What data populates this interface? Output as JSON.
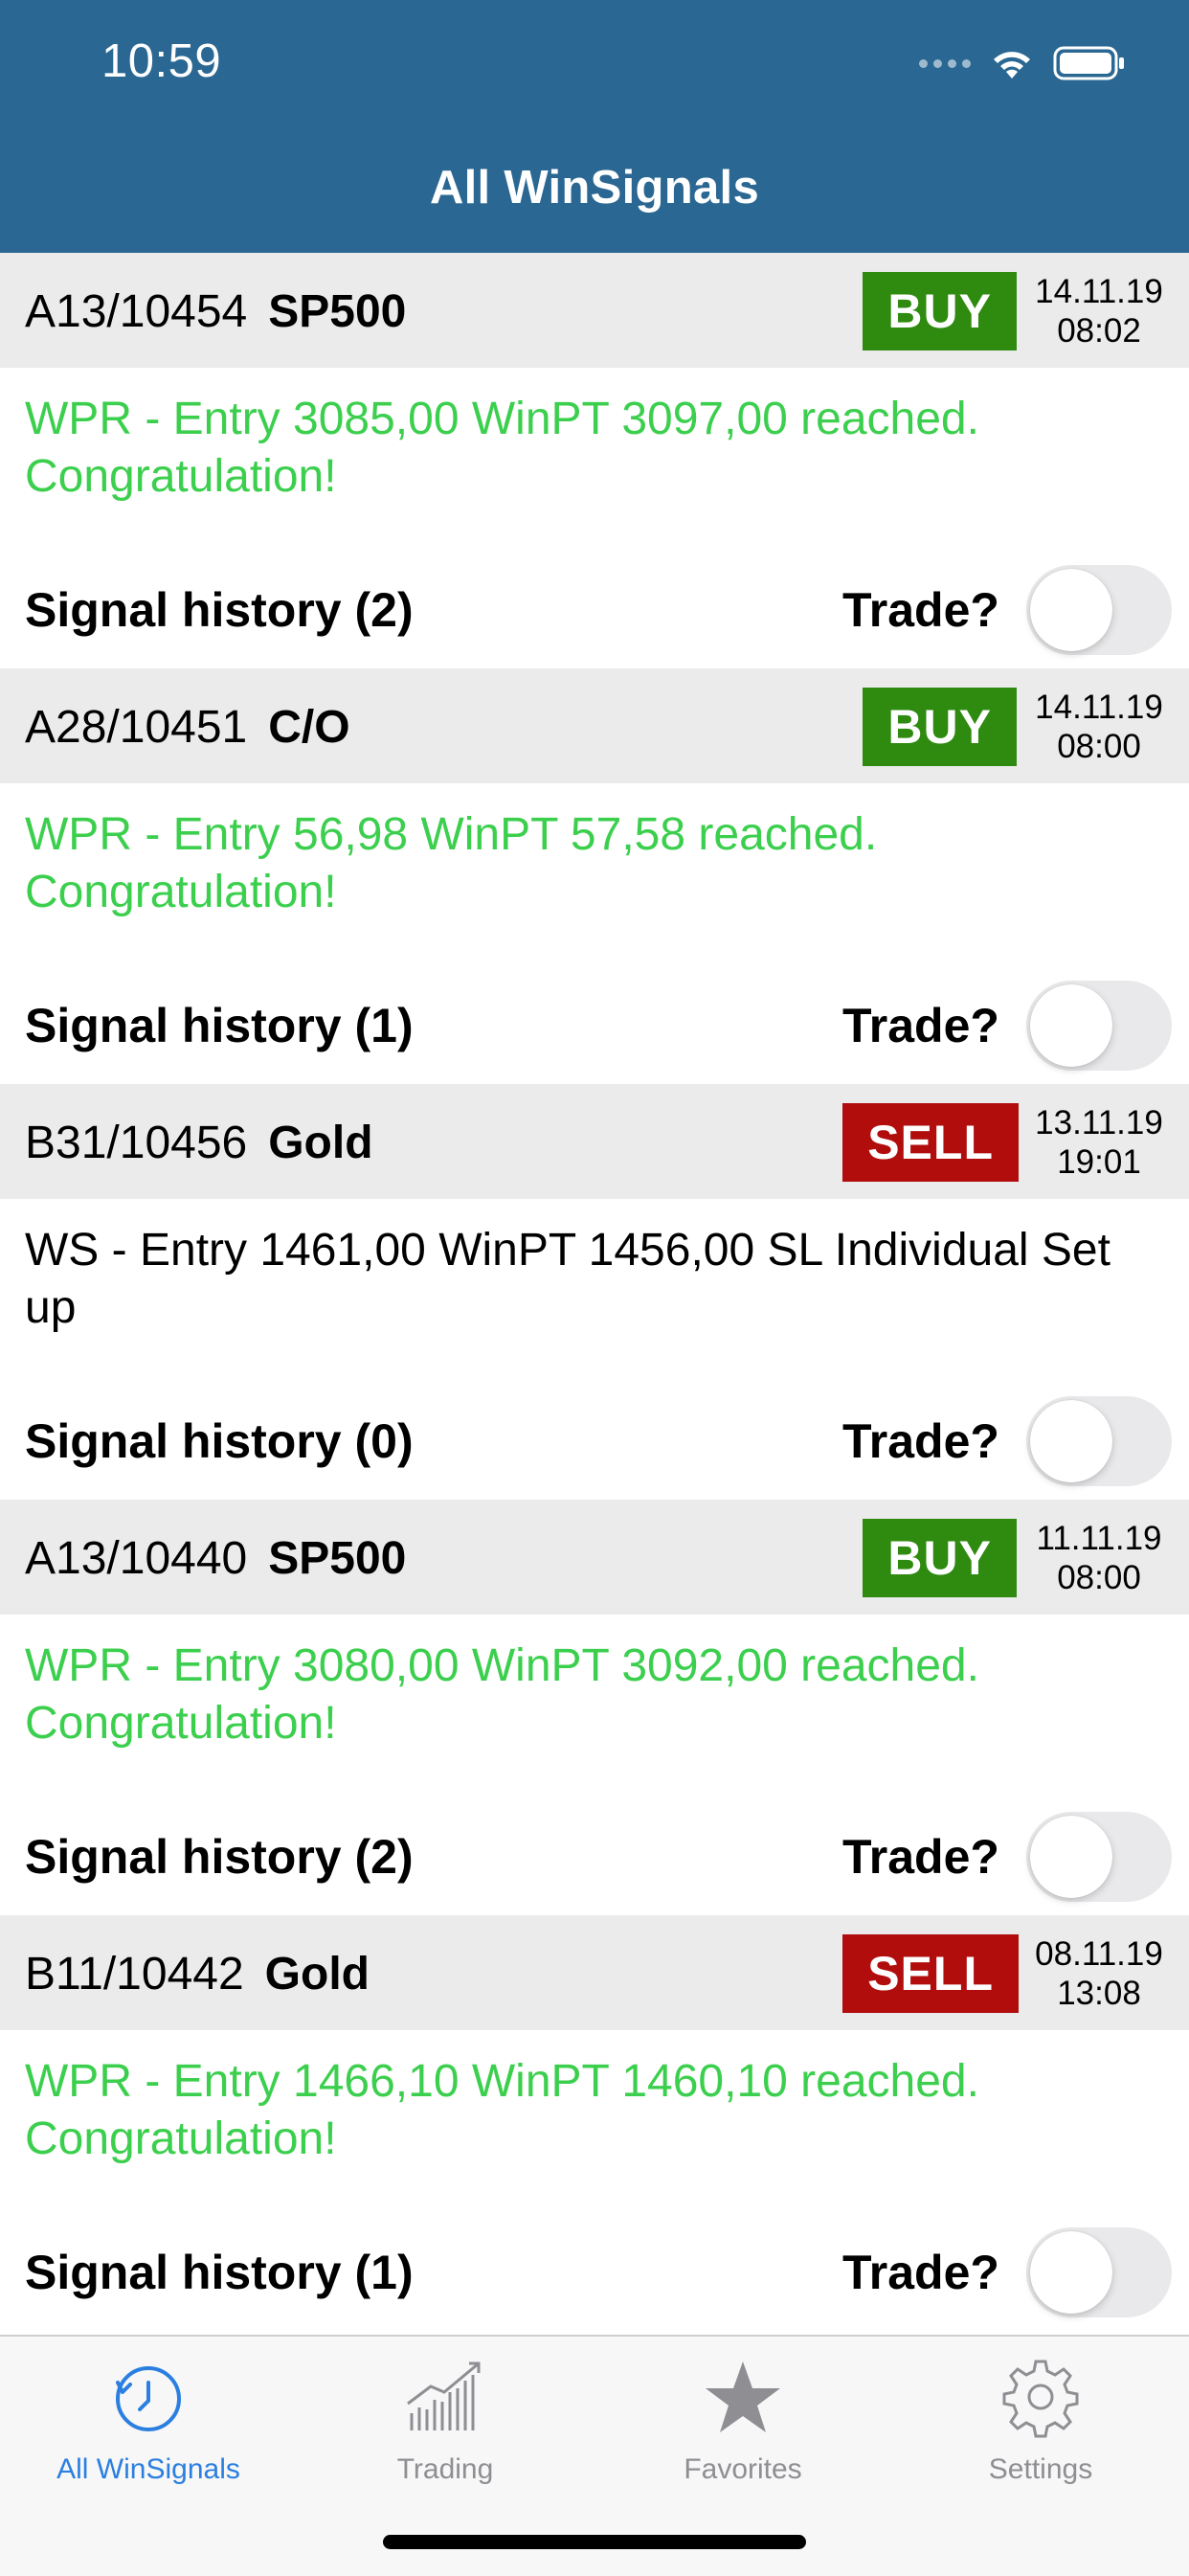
{
  "status_bar": {
    "time": "10:59"
  },
  "nav": {
    "title": "All WinSignals"
  },
  "signals": [
    {
      "code": "A13/10454",
      "asset": "SP500",
      "action": "BUY",
      "date": "14.11.19",
      "time": "08:02",
      "message": "WPR - Entry 3085,00 WinPT 3097,00 reached. Congratulation!",
      "history_label": "Signal history (2)",
      "trade_label": "Trade?",
      "trade_on": false
    },
    {
      "code": "A28/10451",
      "asset": "C/O",
      "action": "BUY",
      "date": "14.11.19",
      "time": "08:00",
      "message": "WPR - Entry 56,98 WinPT 57,58 reached. Congratulation!",
      "history_label": "Signal history (1)",
      "trade_label": "Trade?",
      "trade_on": false
    },
    {
      "code": "B31/10456",
      "asset": "Gold",
      "action": "SELL",
      "date": "13.11.19",
      "time": "19:01",
      "message": "WS - Entry 1461,00 WinPT 1456,00 SL Individual Set up",
      "history_label": "Signal history (0)",
      "trade_label": "Trade?",
      "trade_on": false
    },
    {
      "code": "A13/10440",
      "asset": "SP500",
      "action": "BUY",
      "date": "11.11.19",
      "time": "08:00",
      "message": "WPR - Entry 3080,00 WinPT 3092,00 reached. Congratulation!",
      "history_label": "Signal history (2)",
      "trade_label": "Trade?",
      "trade_on": false
    },
    {
      "code": "B11/10442",
      "asset": "Gold",
      "action": "SELL",
      "date": "08.11.19",
      "time": "13:08",
      "message": "WPR - Entry 1466,10 WinPT 1460,10 reached. Congratulation!",
      "history_label": "Signal history (1)",
      "trade_label": "Trade?",
      "trade_on": false
    }
  ],
  "tabs": [
    {
      "label": "All WinSignals",
      "icon": "clock-icon",
      "active": true
    },
    {
      "label": "Trading",
      "icon": "chart-icon",
      "active": false
    },
    {
      "label": "Favorites",
      "icon": "star-icon",
      "active": false
    },
    {
      "label": "Settings",
      "icon": "gear-icon",
      "active": false
    }
  ],
  "colors": {
    "header": "#2a6792",
    "buy": "#2f8a10",
    "sell": "#b20d0d",
    "reached": "#3ccf4e",
    "tab_active": "#2b7fe0",
    "tab_inactive": "#8e8e93"
  }
}
